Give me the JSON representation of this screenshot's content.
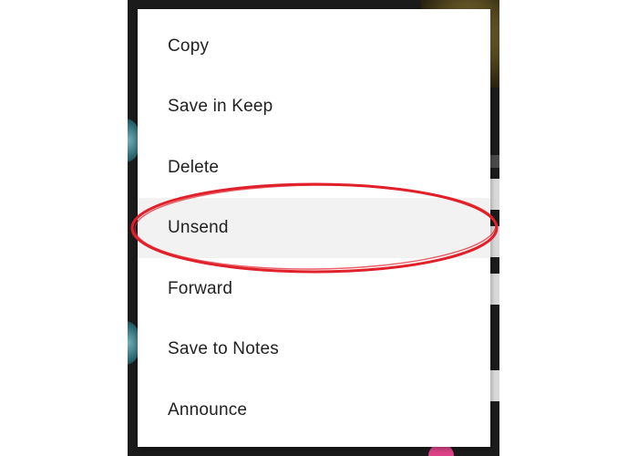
{
  "colors": {
    "menu_background": "#ffffff",
    "highlight_background": "#f2f2f2",
    "text": "#222222",
    "annotation": "#e0202a",
    "screen_background": "#1b1b1b"
  },
  "menu": {
    "items": [
      {
        "label": "Copy"
      },
      {
        "label": "Save in Keep"
      },
      {
        "label": "Delete"
      },
      {
        "label": "Unsend",
        "highlighted": true
      },
      {
        "label": "Forward"
      },
      {
        "label": "Save to Notes"
      },
      {
        "label": "Announce"
      }
    ]
  },
  "annotation": {
    "shape": "ellipse",
    "target": "Unsend"
  }
}
